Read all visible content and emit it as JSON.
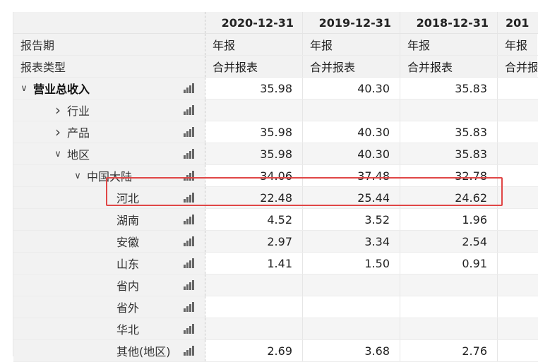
{
  "header": {
    "dates": [
      "2020-12-31",
      "2019-12-31",
      "2018-12-31",
      "201"
    ]
  },
  "meta_rows": [
    {
      "label": "报告期",
      "values": [
        "年报",
        "年报",
        "年报",
        "年报"
      ]
    },
    {
      "label": "报表类型",
      "values": [
        "合并报表",
        "合并报表",
        "合并报表",
        "合并报"
      ]
    }
  ],
  "rows": [
    {
      "label": "营业总收入",
      "indent": 0,
      "chevron": "down",
      "bold": true,
      "values": [
        "35.98",
        "40.30",
        "35.83",
        ""
      ]
    },
    {
      "label": "行业",
      "indent": 1,
      "chevron": "right",
      "values": [
        "",
        "",
        "",
        ""
      ]
    },
    {
      "label": "产品",
      "indent": 1,
      "chevron": "right",
      "values": [
        "35.98",
        "40.30",
        "35.83",
        ""
      ]
    },
    {
      "label": "地区",
      "indent": 1,
      "chevron": "down",
      "values": [
        "35.98",
        "40.30",
        "35.83",
        ""
      ]
    },
    {
      "label": "中国大陆",
      "indent": 2,
      "chevron": "down",
      "values": [
        "34.06",
        "37.48",
        "32.78",
        ""
      ]
    },
    {
      "label": "河北",
      "indent": 3,
      "chevron": "",
      "values": [
        "22.48",
        "25.44",
        "24.62",
        ""
      ]
    },
    {
      "label": "湖南",
      "indent": 3,
      "chevron": "",
      "values": [
        "4.52",
        "3.52",
        "1.96",
        ""
      ]
    },
    {
      "label": "安徽",
      "indent": 3,
      "chevron": "",
      "values": [
        "2.97",
        "3.34",
        "2.54",
        ""
      ]
    },
    {
      "label": "山东",
      "indent": 3,
      "chevron": "",
      "values": [
        "1.41",
        "1.50",
        "0.91",
        ""
      ]
    },
    {
      "label": "省内",
      "indent": 3,
      "chevron": "",
      "values": [
        "",
        "",
        "",
        ""
      ]
    },
    {
      "label": "省外",
      "indent": 3,
      "chevron": "",
      "values": [
        "",
        "",
        "",
        ""
      ]
    },
    {
      "label": "华北",
      "indent": 3,
      "chevron": "",
      "values": [
        "",
        "",
        "",
        ""
      ]
    },
    {
      "label": "其他(地区)",
      "indent": 3,
      "chevron": "",
      "values": [
        "2.69",
        "3.68",
        "2.76",
        ""
      ]
    }
  ],
  "icons": {
    "chart": "bar-chart-icon",
    "expand": "chevron-right-icon",
    "collapse": "chevron-down-icon"
  },
  "colors": {
    "highlight": "#e04646",
    "header_bg": "#f2f2f2"
  }
}
